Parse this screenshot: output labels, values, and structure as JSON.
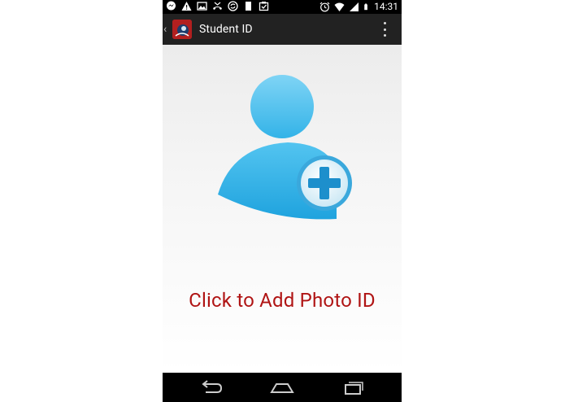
{
  "status_bar": {
    "time": "14:31",
    "left_icons": [
      "messenger-icon",
      "warning-icon",
      "image-icon",
      "missed-call-icon",
      "sync-icon",
      "sd-card-icon",
      "checklist-icon"
    ],
    "right_icons": [
      "alarm-icon",
      "wifi-icon",
      "signal-icon",
      "battery-icon"
    ]
  },
  "action_bar": {
    "title": "Student ID",
    "icon": "app-logo-icon"
  },
  "main": {
    "cta_text": "Click to Add Photo ID",
    "cta_color": "#b01414",
    "avatar_color": "#29abe2",
    "plus_color": "#1d8fcc"
  },
  "nav_bar": {
    "buttons": [
      "back-icon",
      "home-icon",
      "recents-icon"
    ]
  }
}
